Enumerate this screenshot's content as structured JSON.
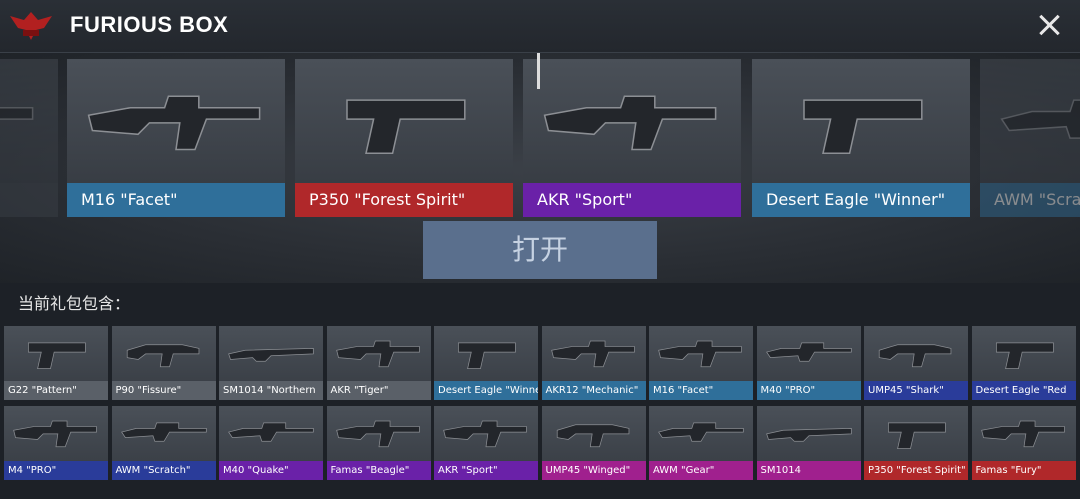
{
  "header": {
    "title": "FURIOUS BOX",
    "logo_icon": "eagle-emblem-icon",
    "close_icon": "close-icon"
  },
  "reel": [
    {
      "label": "",
      "color": "#3c4249",
      "dim": true,
      "gun": "rifle"
    },
    {
      "label": "M16 \"Facet\"",
      "color": "#2f6f9a",
      "gun": "rifle"
    },
    {
      "label": "P350 \"Forest Spirit\"",
      "color": "#b0282a",
      "gun": "pistol"
    },
    {
      "label": "AKR \"Sport\"",
      "color": "#6a21a8",
      "gun": "rifle"
    },
    {
      "label": "Desert Eagle \"Winner\"",
      "color": "#2f6f9a",
      "gun": "pistol"
    },
    {
      "label": "AWM \"Scra",
      "color": "#2f6f9a",
      "dim": true,
      "gun": "sniper"
    }
  ],
  "open_button": "打开",
  "contains_label": "当前礼包包含：",
  "items": [
    {
      "label": "G22 \"Pattern\"",
      "color": "#5a6068",
      "gun": "pistol"
    },
    {
      "label": "P90 \"Fissure\"",
      "color": "#5a6068",
      "gun": "smg"
    },
    {
      "label": "SM1014 \"Northern",
      "color": "#5a6068",
      "gun": "shotgun"
    },
    {
      "label": "AKR \"Tiger\"",
      "color": "#5a6068",
      "gun": "rifle"
    },
    {
      "label": "Desert Eagle \"Winner\"",
      "color": "#2f6f9a",
      "gun": "pistol"
    },
    {
      "label": "AKR12 \"Mechanic\"",
      "color": "#2f6f9a",
      "gun": "rifle"
    },
    {
      "label": "M16 \"Facet\"",
      "color": "#2f6f9a",
      "gun": "rifle"
    },
    {
      "label": "M40 \"PRO\"",
      "color": "#2f6f9a",
      "gun": "sniper"
    },
    {
      "label": "UMP45 \"Shark\"",
      "color": "#2a3c9a",
      "gun": "smg"
    },
    {
      "label": "Desert Eagle \"Red",
      "color": "#2a3c9a",
      "gun": "pistol"
    },
    {
      "label": "M4 \"PRO\"",
      "color": "#2a3c9a",
      "gun": "rifle"
    },
    {
      "label": "AWM \"Scratch\"",
      "color": "#2a3c9a",
      "gun": "sniper"
    },
    {
      "label": "M40 \"Quake\"",
      "color": "#6a21a8",
      "gun": "sniper"
    },
    {
      "label": "Famas \"Beagle\"",
      "color": "#6a21a8",
      "gun": "rifle"
    },
    {
      "label": "AKR \"Sport\"",
      "color": "#6a21a8",
      "gun": "rifle"
    },
    {
      "label": "UMP45 \"Winged\"",
      "color": "#a0208e",
      "gun": "smg"
    },
    {
      "label": "AWM \"Gear\"",
      "color": "#a0208e",
      "gun": "sniper"
    },
    {
      "label": "SM1014",
      "color": "#a0208e",
      "gun": "shotgun"
    },
    {
      "label": "P350 \"Forest Spirit\"",
      "color": "#b0282a",
      "gun": "pistol"
    },
    {
      "label": "Famas \"Fury\"",
      "color": "#b0282a",
      "gun": "rifle"
    }
  ]
}
